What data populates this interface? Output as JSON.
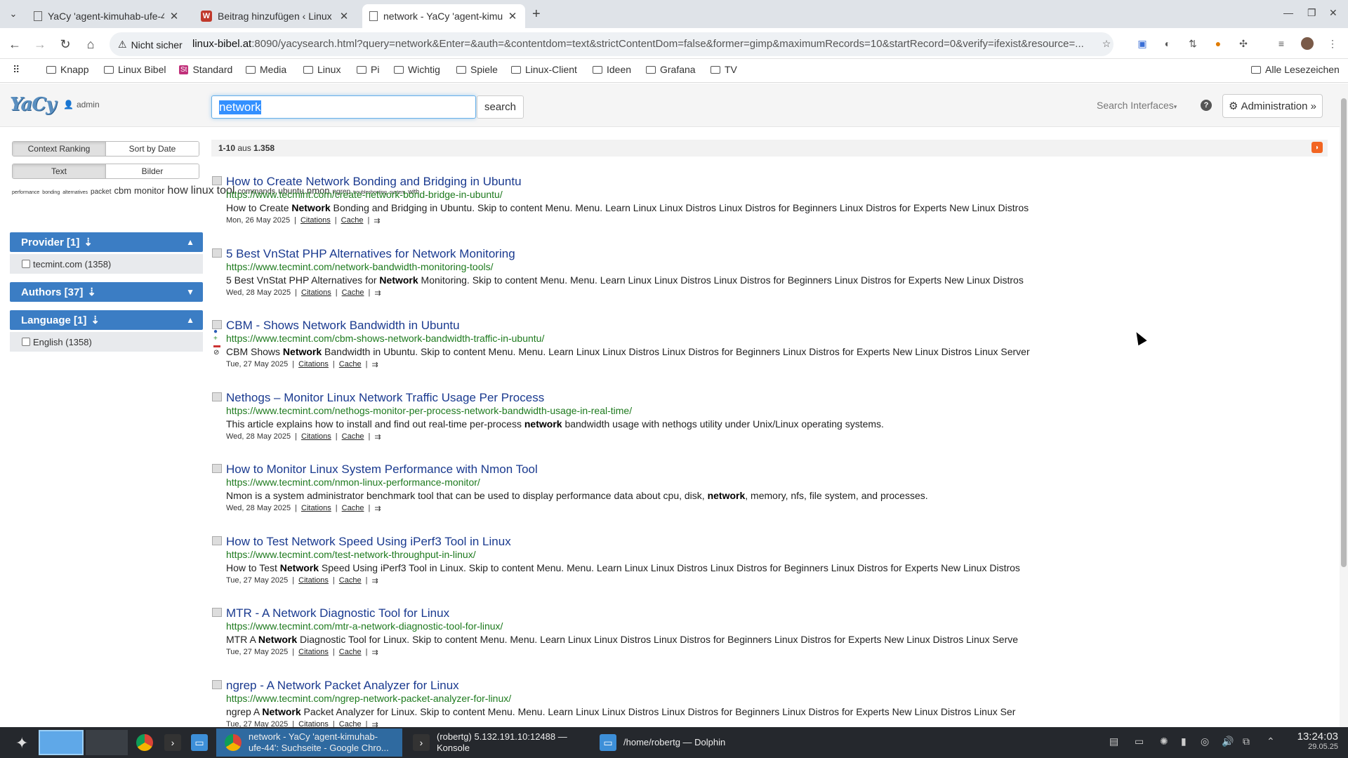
{
  "browser": {
    "tabs": [
      {
        "title": "YaCy 'agent-kimuhab-ufe-4",
        "icon": "document-icon"
      },
      {
        "title": "Beitrag hinzufügen ‹ Linux",
        "icon": "wordpress-icon"
      },
      {
        "title": "network - YaCy 'agent-kimu",
        "icon": "document-icon"
      }
    ],
    "security_label": "Nicht sicher",
    "url_host": "linux-bibel.at",
    "url_rest": ":8090/yacysearch.html?query=network&Enter=&auth=&contentdom=text&strictContentDom=false&former=gimp&maximumRecords=10&startRecord=0&verify=ifexist&resource=...",
    "bookmarks": [
      "Knapp",
      "Linux Bibel",
      "Standard",
      "Media",
      "Linux",
      "Pi",
      "Wichtig",
      "Spiele",
      "Linux-Client",
      "Ideen",
      "Grafana",
      "TV"
    ],
    "all_bookmarks": "Alle Lesezeichen",
    "standard_badge": "St"
  },
  "yacy": {
    "logo_text": "YaCy",
    "admin_label": "admin",
    "query": "network",
    "search_button": "search",
    "search_interfaces": "Search Interfaces",
    "help": "?",
    "administration": "Administration »",
    "ranking": {
      "context": "Context Ranking",
      "date": "Sort by Date"
    },
    "media": {
      "text": "Text",
      "images": "Bilder"
    },
    "tagcloud": [
      {
        "word": "performance",
        "size": 7
      },
      {
        "word": "bonding",
        "size": 7
      },
      {
        "word": "alternatives",
        "size": 7
      },
      {
        "word": "packet",
        "size": 10
      },
      {
        "word": "cbm",
        "size": 13
      },
      {
        "word": "monitor",
        "size": 13
      },
      {
        "word": "how",
        "size": 16
      },
      {
        "word": "linux",
        "size": 16
      },
      {
        "word": "tool",
        "size": 16
      },
      {
        "word": "commands",
        "size": 11
      },
      {
        "word": "ubuntu",
        "size": 12
      },
      {
        "word": "nmon",
        "size": 13
      },
      {
        "word": "ngrep",
        "size": 10
      },
      {
        "word": "troubleshooting",
        "size": 7
      },
      {
        "word": "system",
        "size": 7
      },
      {
        "word": "with",
        "size": 9
      }
    ],
    "facets": {
      "provider": {
        "title": "Provider [1]",
        "item": "tecmint.com (1358)"
      },
      "authors": {
        "title": "Authors [37]"
      },
      "language": {
        "title": "Language [1]",
        "item": "English (1358)"
      }
    },
    "result_count_prefix": "1-10",
    "result_count_middle": " aus ",
    "result_count_total": "1.358",
    "citations_label": "Citations",
    "cache_label": "Cache",
    "results": [
      {
        "title": "How to Create Network Bonding and Bridging in Ubuntu",
        "url": "https://www.tecmint.com/create-network-bond-bridge-in-ubuntu/",
        "snip_pre": "How to Create ",
        "snip_bold": "Network",
        "snip_post": " Bonding and Bridging in Ubuntu. Skip to content Menu. Menu. Learn Linux Linux Distros Linux Distros for Beginners Linux Distros for Experts New Linux Distros",
        "date": "Mon, 26 May 2025"
      },
      {
        "title": "5 Best VnStat PHP Alternatives for Network Monitoring",
        "url": "https://www.tecmint.com/network-bandwidth-monitoring-tools/",
        "snip_pre": "5 Best VnStat PHP Alternatives for ",
        "snip_bold": "Network",
        "snip_post": " Monitoring. Skip to content Menu. Menu. Learn Linux Linux Distros Linux Distros for Beginners Linux Distros for Experts New Linux Distros",
        "date": "Wed, 28 May 2025"
      },
      {
        "title": "CBM - Shows Network Bandwidth in Ubuntu",
        "url": "https://www.tecmint.com/cbm-shows-network-bandwidth-traffic-in-ubuntu/",
        "snip_pre": "CBM Shows ",
        "snip_bold": "Network",
        "snip_post": " Bandwidth in Ubuntu. Skip to content Menu. Menu. Learn Linux Linux Distros Linux Distros for Beginners Linux Distros for Experts New Linux Distros Linux Server",
        "date": "Tue, 27 May 2025"
      },
      {
        "title": "Nethogs – Monitor Linux Network Traffic Usage Per Process",
        "url": "https://www.tecmint.com/nethogs-monitor-per-process-network-bandwidth-usage-in-real-time/",
        "snip_pre": "This article explains how to install and find out real-time per-process ",
        "snip_bold": "network",
        "snip_post": " bandwidth usage with nethogs utility under Unix/Linux operating systems.",
        "date": "Wed, 28 May 2025"
      },
      {
        "title": "How to Monitor Linux System Performance with Nmon Tool",
        "url": "https://www.tecmint.com/nmon-linux-performance-monitor/",
        "snip_pre": "Nmon is a system administrator benchmark tool that can be used to display performance data about cpu, disk, ",
        "snip_bold": "network",
        "snip_post": ", memory, nfs, file system, and processes.",
        "date": "Wed, 28 May 2025"
      },
      {
        "title": "How to Test Network Speed Using iPerf3 Tool in Linux",
        "url": "https://www.tecmint.com/test-network-throughput-in-linux/",
        "snip_pre": "How to Test ",
        "snip_bold": "Network",
        "snip_post": " Speed Using iPerf3 Tool in Linux. Skip to content Menu. Menu. Learn Linux Linux Distros Linux Distros for Beginners Linux Distros for Experts New Linux Distros",
        "date": "Tue, 27 May 2025"
      },
      {
        "title": "MTR - A Network Diagnostic Tool for Linux",
        "url": "https://www.tecmint.com/mtr-a-network-diagnostic-tool-for-linux/",
        "snip_pre": "MTR A ",
        "snip_bold": "Network",
        "snip_post": " Diagnostic Tool for Linux. Skip to content Menu. Menu. Learn Linux Linux Distros Linux Distros for Beginners Linux Distros for Experts New Linux Distros Linux Serve",
        "date": "Tue, 27 May 2025"
      },
      {
        "title": "ngrep - A Network Packet Analyzer for Linux",
        "url": "https://www.tecmint.com/ngrep-network-packet-analyzer-for-linux/",
        "snip_pre": "ngrep A ",
        "snip_bold": "Network",
        "snip_post": " Packet Analyzer for Linux. Skip to content Menu. Menu. Learn Linux Linux Distros Linux Distros for Beginners Linux Distros for Experts New Linux Distros Linux Ser",
        "date": "Tue, 27 May 2025"
      }
    ]
  },
  "taskbar": {
    "tasks": [
      {
        "line1": "network - YaCy 'agent-kimuhab-",
        "line2": "ufe-44': Suchseite - Google Chro..."
      },
      {
        "line1": "(robertg) 5.132.191.10:12488 —",
        "line2": "Konsole"
      },
      {
        "line1": "/home/robertg — Dolphin",
        "line2": ""
      }
    ],
    "time": "13:24:03",
    "date": "29.05.25"
  },
  "colors": {
    "accent": "#3b7dc4",
    "link": "#1a3a8f",
    "url_green": "#1e7a1e",
    "taskbar": "#25282d"
  }
}
